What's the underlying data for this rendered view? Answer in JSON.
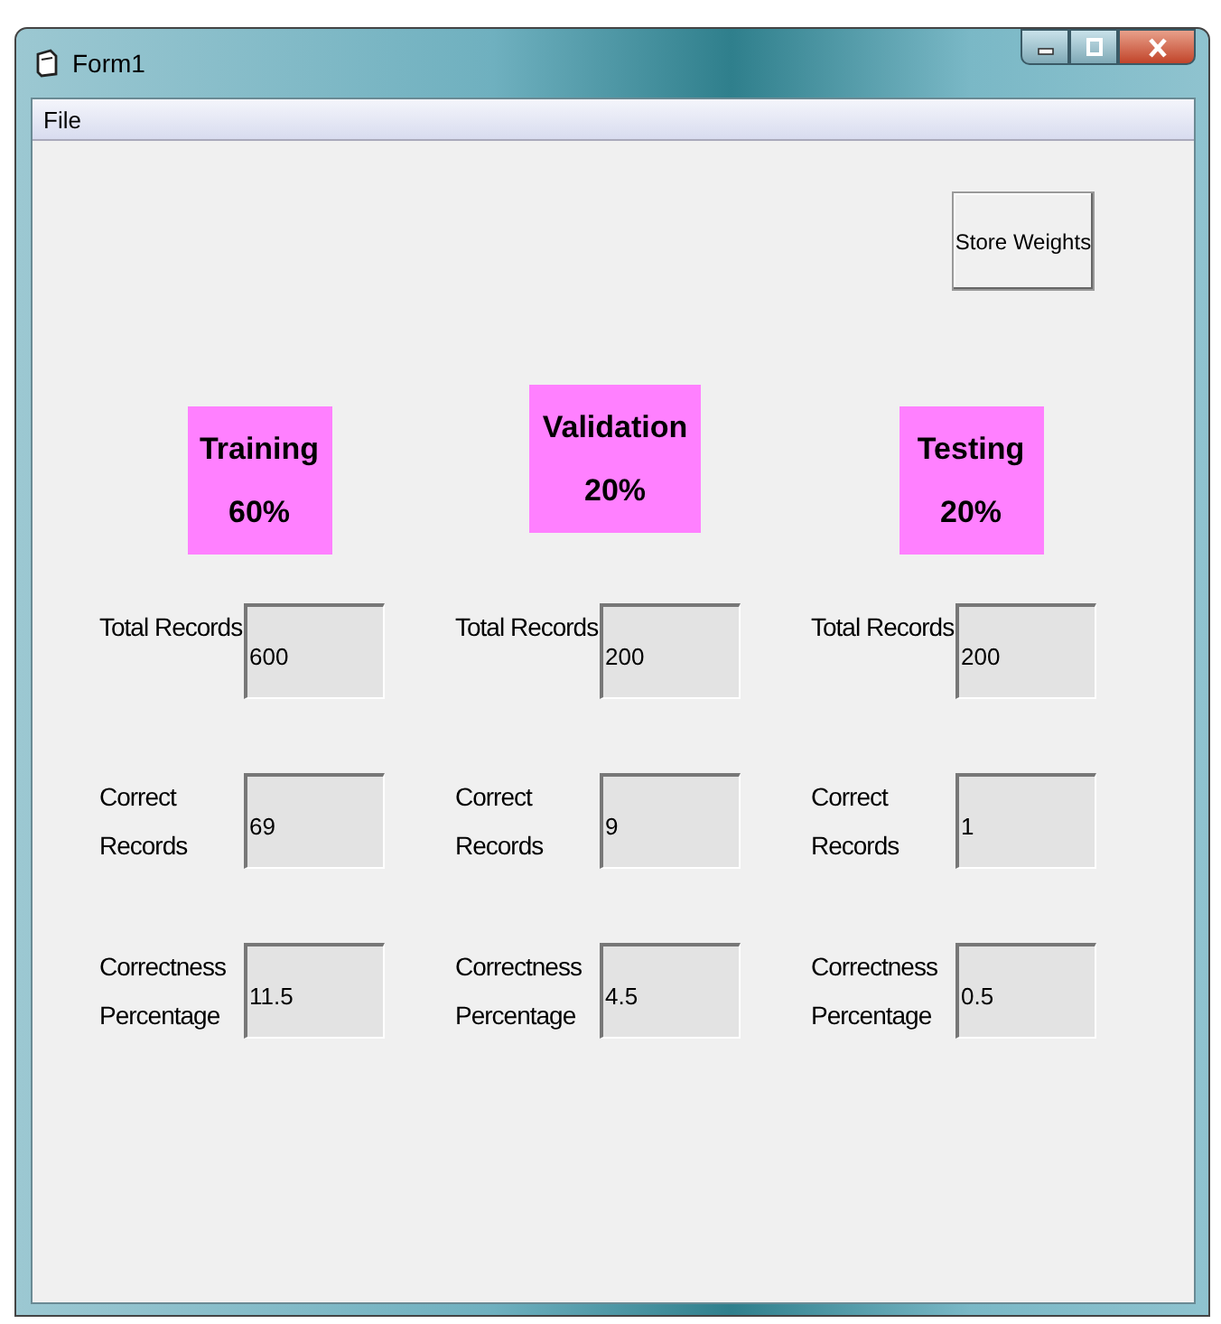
{
  "window": {
    "title": "Form1"
  },
  "menu": [
    "File"
  ],
  "store_button": "Store Weights",
  "columns": [
    {
      "heading": "Training 60%",
      "raised": false,
      "fields": [
        {
          "label": "Total Records",
          "value": "600"
        },
        {
          "label": "Correct Records",
          "value": "69"
        },
        {
          "label": "Correctness Percentage",
          "value": "11.5"
        }
      ]
    },
    {
      "heading": "Validation 20%",
      "raised": true,
      "fields": [
        {
          "label": "Total Records",
          "value": "200"
        },
        {
          "label": "Correct Records",
          "value": "9"
        },
        {
          "label": "Correctness Percentage",
          "value": "4.5"
        }
      ]
    },
    {
      "heading": "Testing 20%",
      "raised": false,
      "fields": [
        {
          "label": "Total Records",
          "value": "200"
        },
        {
          "label": "Correct Records",
          "value": "1"
        },
        {
          "label": "Correctness Percentage",
          "value": "0.5"
        }
      ]
    }
  ]
}
